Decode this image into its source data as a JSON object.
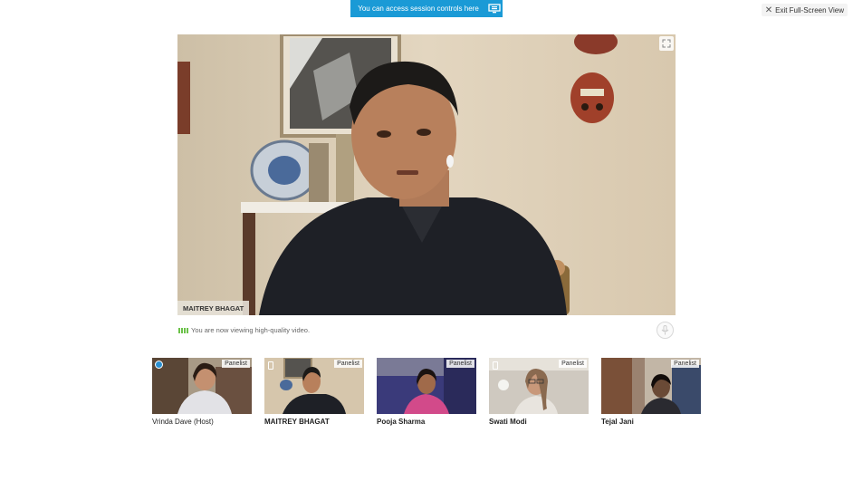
{
  "session_tip": {
    "text": "You can access session controls here",
    "icon": "session-controls-icon"
  },
  "exit_fullscreen": {
    "icon": "close-icon",
    "label": "Exit Full-Screen View"
  },
  "main_video": {
    "speaker": "MAITREY BHAGAT",
    "expand_icon": "expand-icon"
  },
  "quality_notice": {
    "icon": "signal-bars-icon",
    "text": "You are now viewing high-quality video."
  },
  "mic": {
    "icon": "microphone-icon"
  },
  "participants": [
    {
      "name": "Vrinda Dave (Host)",
      "role": "Panelist"
    },
    {
      "name": "MAITREY BHAGAT",
      "role": "Panelist"
    },
    {
      "name": "Pooja Sharma",
      "role": "Panelist"
    },
    {
      "name": "Swati Modi",
      "role": "Panelist"
    },
    {
      "name": "Tejal Jani",
      "role": "Panelist"
    }
  ],
  "colors": {
    "accent": "#1a9ad6",
    "signal": "#6cc24a"
  }
}
